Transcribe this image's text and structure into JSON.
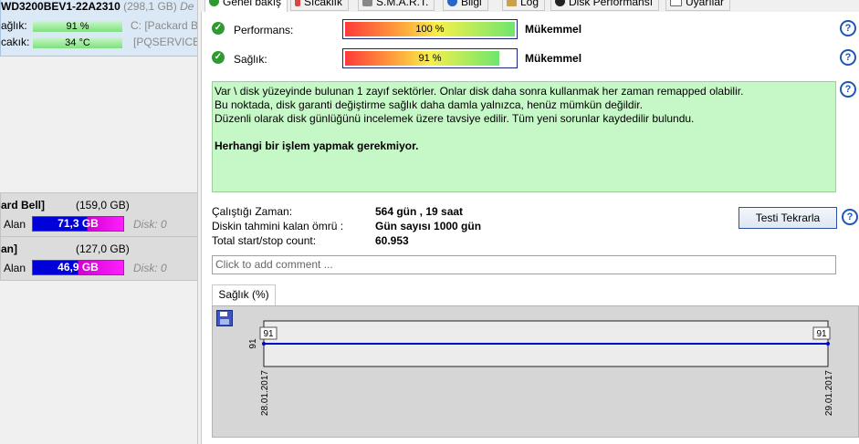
{
  "left": {
    "drive_header": {
      "title": "WD3200BEV1-22A2310",
      "size": "(298,1 GB)",
      "title_tail": "De"
    },
    "rows": [
      {
        "label": "ağlık:",
        "value": "91 %",
        "drive": "C: [Packard Be"
      },
      {
        "label": "cakık:",
        "value": "34 °C",
        "drive": "[PQSERVICE],"
      }
    ],
    "partitions": [
      {
        "name": "ard Bell]",
        "size": "(159,0 GB)",
        "alan_label": "Alan",
        "free": "71,3",
        "free_unit": "GB",
        "disk_label": "Disk:",
        "disk_val": "0"
      },
      {
        "name": "an]",
        "size": "(127,0 GB)",
        "alan_label": "Alan",
        "free": "46,9",
        "free_unit": "GB",
        "disk_label": "Disk:",
        "disk_val": "0"
      }
    ]
  },
  "tabs": [
    "Genel bakış",
    "Sıcaklık",
    "S.M.A.R.T.",
    "Bilgi",
    "Log",
    "Disk Performansı",
    "Uyarılar"
  ],
  "performance": {
    "label": "Performans:",
    "percent": "100 %",
    "fill": 1.0,
    "status": "Mükemmel"
  },
  "health": {
    "label": "Sağlık:",
    "percent": "91 %",
    "fill": 0.91,
    "status": "Mükemmel"
  },
  "message": {
    "lines": [
      "Var \\ disk yüzeyinde bulunan 1 zayıf sektörler. Onlar disk daha sonra kullanmak her zaman remapped olabilir.",
      "Bu noktada, disk garanti değiştirme sağlık daha damla yalnızca, henüz mümkün değildir.",
      "Düzenli olarak disk günlüğünü incelemek üzere tavsiye edilir. Tüm yeni sorunlar kaydedilir bulundu."
    ],
    "bold_line": "Herhangi bir işlem yapmak gerekmiyor."
  },
  "stats": {
    "running_label": "Çalıştığı Zaman:",
    "running_value": "564 gün , 19 saat",
    "lifetime_label": "Diskin tahmini kalan ömrü :",
    "lifetime_value": "Gün sayısı  1000 gün",
    "startstop_label": "Total start/stop count:",
    "startstop_value": "60.953"
  },
  "retest_button": "Testi Tekrarla",
  "comment_placeholder": "Click to add comment ...",
  "chart_tab": "Sağlık  (%)",
  "chart_data": {
    "type": "line",
    "x": [
      "28.01.2017",
      "29.01.2017"
    ],
    "series": [
      {
        "values": [
          91,
          91
        ]
      }
    ],
    "y_tick_labels": [
      "91"
    ],
    "data_labels": [
      "91",
      "91"
    ]
  },
  "colors": {
    "accent": "#1a237e",
    "line": "#0000cc",
    "message_bg": "#c6f7c6"
  }
}
